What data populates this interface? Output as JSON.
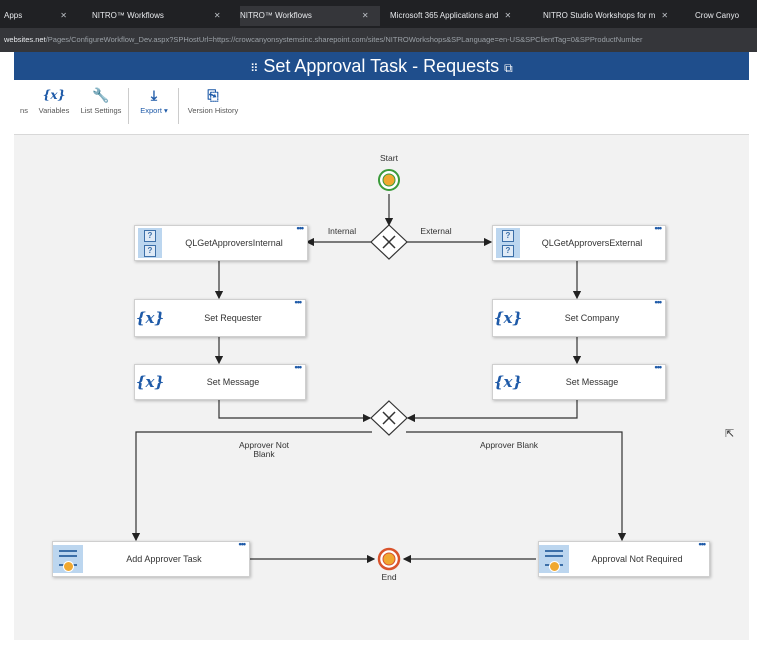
{
  "browser": {
    "tabs": [
      {
        "label": "Apps"
      },
      {
        "label": "NITRO™ Workflows"
      },
      {
        "label": "NITRO™ Workflows"
      },
      {
        "label": "Microsoft 365 Applications and"
      },
      {
        "label": "NITRO Studio Workshops for m"
      },
      {
        "label": "Crow Canyo"
      }
    ],
    "url_host": "websites.net",
    "url_rest": "/Pages/ConfigureWorkflow_Dev.aspx?SPHostUrl=https://crowcanyonsystemsinc.sharepoint.com/sites/NITROWorkshops&SPLanguage=en-US&SPClientTag=0&SPProductNumber"
  },
  "page": {
    "title": "Set Approval Task - Requests"
  },
  "ribbon": {
    "items": [
      {
        "label": "ns",
        "icon": ""
      },
      {
        "label": "Variables",
        "icon": "{x}"
      },
      {
        "label": "List Settings",
        "icon": "wrench-icon"
      },
      {
        "label": "Export ▾",
        "icon": "download-icon"
      },
      {
        "label": "Version History",
        "icon": "version-history-icon"
      }
    ]
  },
  "workflow": {
    "start_label": "Start",
    "end_label": "End",
    "branch_internal": "Internal",
    "branch_external": "External",
    "branch_not_blank": "Approver Not Blank",
    "branch_blank": "Approver Blank",
    "menu_dots": "•••",
    "var_icon_text": "{x}",
    "query_icon_text": "?",
    "nodes": {
      "ql_internal": "QLGetApproversInternal",
      "ql_external": "QLGetApproversExternal",
      "set_requester": "Set Requester",
      "set_company": "Set Company",
      "set_message_left": "Set Message",
      "set_message_right": "Set Message",
      "add_approver_task": "Add Approver Task",
      "approval_not_required": "Approval Not Required"
    }
  }
}
